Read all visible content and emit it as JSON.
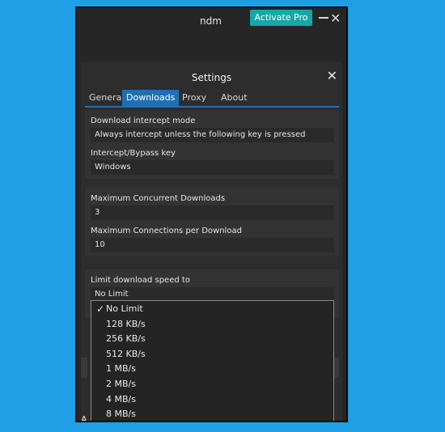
{
  "window": {
    "title": "ndm",
    "activate_label": "Activate Pro"
  },
  "toolbar": {
    "icons": [
      "add-icon",
      "play-icon",
      "pause-icon",
      "timer-icon",
      "move-up-icon",
      "move-down-icon",
      "list-view-icon",
      "grid-view-icon",
      "export-icon",
      "equalizer-icon"
    ]
  },
  "settings": {
    "title": "Settings",
    "tabs": [
      {
        "label": "General",
        "active": false
      },
      {
        "label": "Downloads",
        "active": true
      },
      {
        "label": "Proxy",
        "active": false
      },
      {
        "label": "About",
        "active": false
      }
    ],
    "intercept_mode_label": "Download intercept mode",
    "intercept_mode_value": "Always intercept unless the following key is pressed",
    "bypass_key_label": "Intercept/Bypass key",
    "bypass_key_value": "Windows",
    "max_concurrent_label": "Maximum Concurrent Downloads",
    "max_concurrent_value": "3",
    "max_connections_label": "Maximum Connections per Download",
    "max_connections_value": "10",
    "speed_limit_label": "Limit download speed to",
    "speed_limit_value": "No Limit",
    "speed_options": [
      {
        "label": "No Limit",
        "checked": true
      },
      {
        "label": "128 KB/s",
        "checked": false
      },
      {
        "label": "256 KB/s",
        "checked": false
      },
      {
        "label": "512 KB/s",
        "checked": false
      },
      {
        "label": "1 MB/s",
        "checked": false
      },
      {
        "label": "2 MB/s",
        "checked": false
      },
      {
        "label": "4 MB/s",
        "checked": false
      },
      {
        "label": "8 MB/s",
        "checked": false
      }
    ],
    "hidden_peek_text": "A"
  }
}
